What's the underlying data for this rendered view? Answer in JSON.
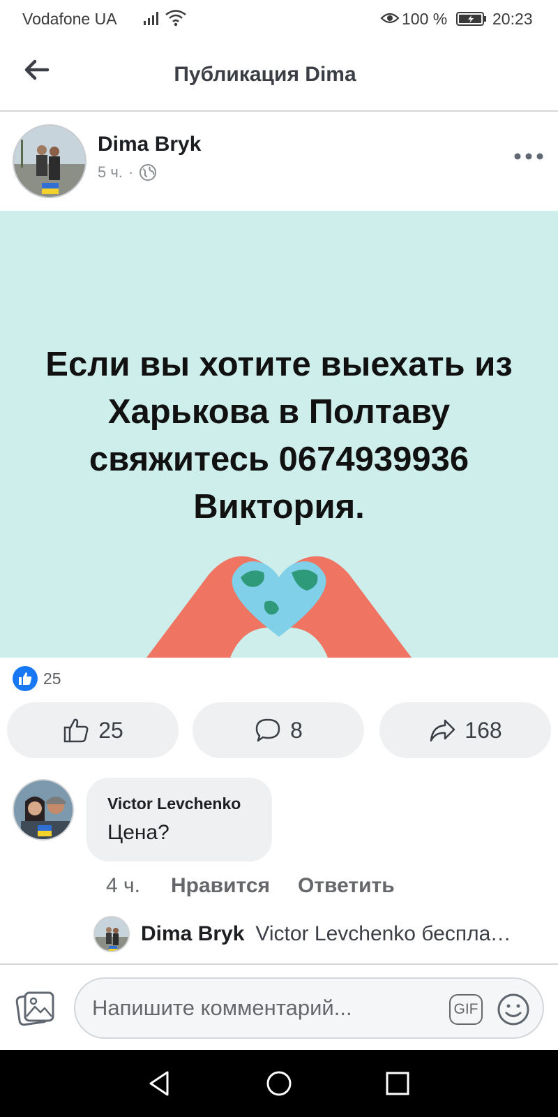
{
  "status_bar": {
    "carrier": "Vodafone UA",
    "battery_percent": "100 %",
    "time": "20:23",
    "icons": [
      "signal-icon",
      "wifi-icon",
      "eye-comfort-icon",
      "battery-icon"
    ]
  },
  "header": {
    "title": "Публикация Dima",
    "back_icon": "back-arrow-icon"
  },
  "post": {
    "author": "Dima Bryk",
    "time": "5 ч.",
    "separator": "·",
    "privacy_icon": "globe-icon",
    "image_text": "Если вы хотите выехать из Харькова в Полтаву свяжитесь 0674939936 Виктория.",
    "image_bg_color": "#cdeeea",
    "reaction_count": "25"
  },
  "actions": {
    "like_count": "25",
    "comment_count": "8",
    "share_count": "168"
  },
  "comment": {
    "author": "Victor Levchenko",
    "text": "Цена?",
    "time": "4 ч.",
    "like_label": "Нравится",
    "reply_label": "Ответить"
  },
  "reply_preview": {
    "author": "Dima Bryk",
    "text": "Victor Levchenko бесплатно"
  },
  "composer": {
    "placeholder": "Напишите комментарий...",
    "gif_label": "GIF"
  },
  "colors": {
    "accent": "#1877f2",
    "hands": "#ef7462",
    "globe_water": "#7fd0e8",
    "globe_land": "#2f9a7a"
  }
}
